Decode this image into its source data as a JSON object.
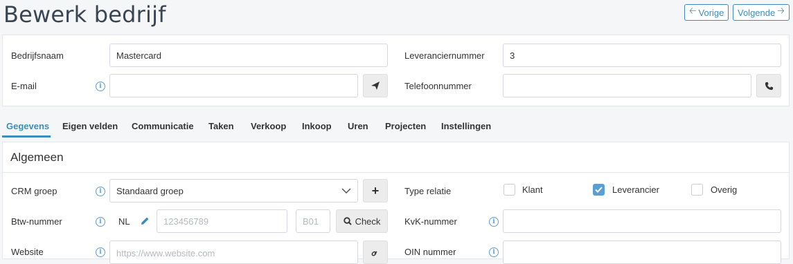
{
  "page": {
    "title": "Bewerk bedrijf"
  },
  "nav": {
    "prev_label": "Vorige",
    "next_label": "Volgende"
  },
  "header_form": {
    "company_name_label": "Bedrijfsnaam",
    "company_name_value": "Mastercard",
    "supplier_number_label": "Leveranciernummer",
    "supplier_number_value": "3",
    "email_label": "E-mail",
    "email_value": "",
    "phone_label": "Telefoonnummer",
    "phone_value": ""
  },
  "tabs": [
    {
      "label": "Gegevens",
      "active": true
    },
    {
      "label": "Eigen velden"
    },
    {
      "label": "Communicatie"
    },
    {
      "label": "Taken"
    },
    {
      "label": "Verkoop"
    },
    {
      "label": "Inkoop"
    },
    {
      "label": "Uren"
    },
    {
      "label": "Projecten"
    },
    {
      "label": "Instellingen"
    }
  ],
  "general": {
    "section_title": "Algemeen",
    "crm_group_label": "CRM groep",
    "crm_group_value": "Standaard groep",
    "relation_type_label": "Type relatie",
    "relation_types": [
      {
        "label": "Klant",
        "checked": false
      },
      {
        "label": "Leverancier",
        "checked": true
      },
      {
        "label": "Overig",
        "checked": false
      }
    ],
    "vat_label": "Btw-nummer",
    "vat_country": "NL",
    "vat_number_placeholder": "123456789",
    "vat_suffix_placeholder": "B01",
    "check_label": "Check",
    "kvk_label": "KvK-nummer",
    "website_label": "Website",
    "website_placeholder": "https://www.website.com",
    "oin_label": "OIN nummer"
  },
  "colors": {
    "accent": "#3c8dbc",
    "title": "#3a4553"
  }
}
